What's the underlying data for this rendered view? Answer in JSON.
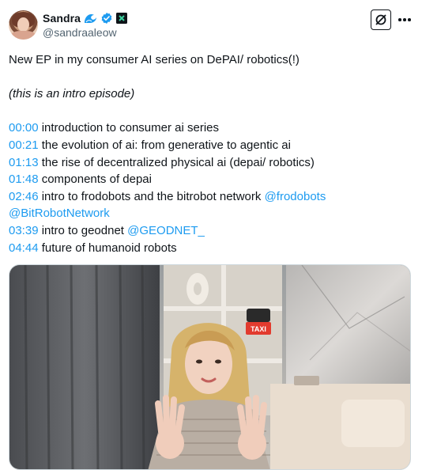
{
  "author": {
    "display_name": "Sandra",
    "handle": "@sandraaleow",
    "badges": [
      "wave-icon",
      "verified-icon",
      "affiliation-icon"
    ]
  },
  "actions": {
    "grok_icon": "grok-icon",
    "more_icon": "more-icon"
  },
  "tweet": {
    "intro": "New EP in my consumer AI series on DePAI/ robotics(!)",
    "note": "(this is an intro episode)",
    "chapters": [
      {
        "time": "00:00",
        "text": " introduction to consumer ai series"
      },
      {
        "time": "00:21",
        "text": " the evolution of ai: from generative to agentic ai"
      },
      {
        "time": "01:13",
        "text": " the rise of decentralized physical ai (depai/ robotics)"
      },
      {
        "time": "01:48",
        "text": " components of depai"
      },
      {
        "time": "02:46",
        "text": " intro to frodobots and the bitrobot network ",
        "mentions": [
          "@frodobots",
          "@BitRobotNetwork"
        ]
      },
      {
        "time": "03:39",
        "text": " intro to geodnet ",
        "mentions": [
          "@GEODNET_"
        ]
      },
      {
        "time": "04:44",
        "text": " future of humanoid robots"
      }
    ]
  },
  "media": {
    "sign_text": "TAXI"
  },
  "colors": {
    "link": "#1d9bf0",
    "text": "#0f1419",
    "secondary": "#536471",
    "verified": "#1d9bf0"
  }
}
